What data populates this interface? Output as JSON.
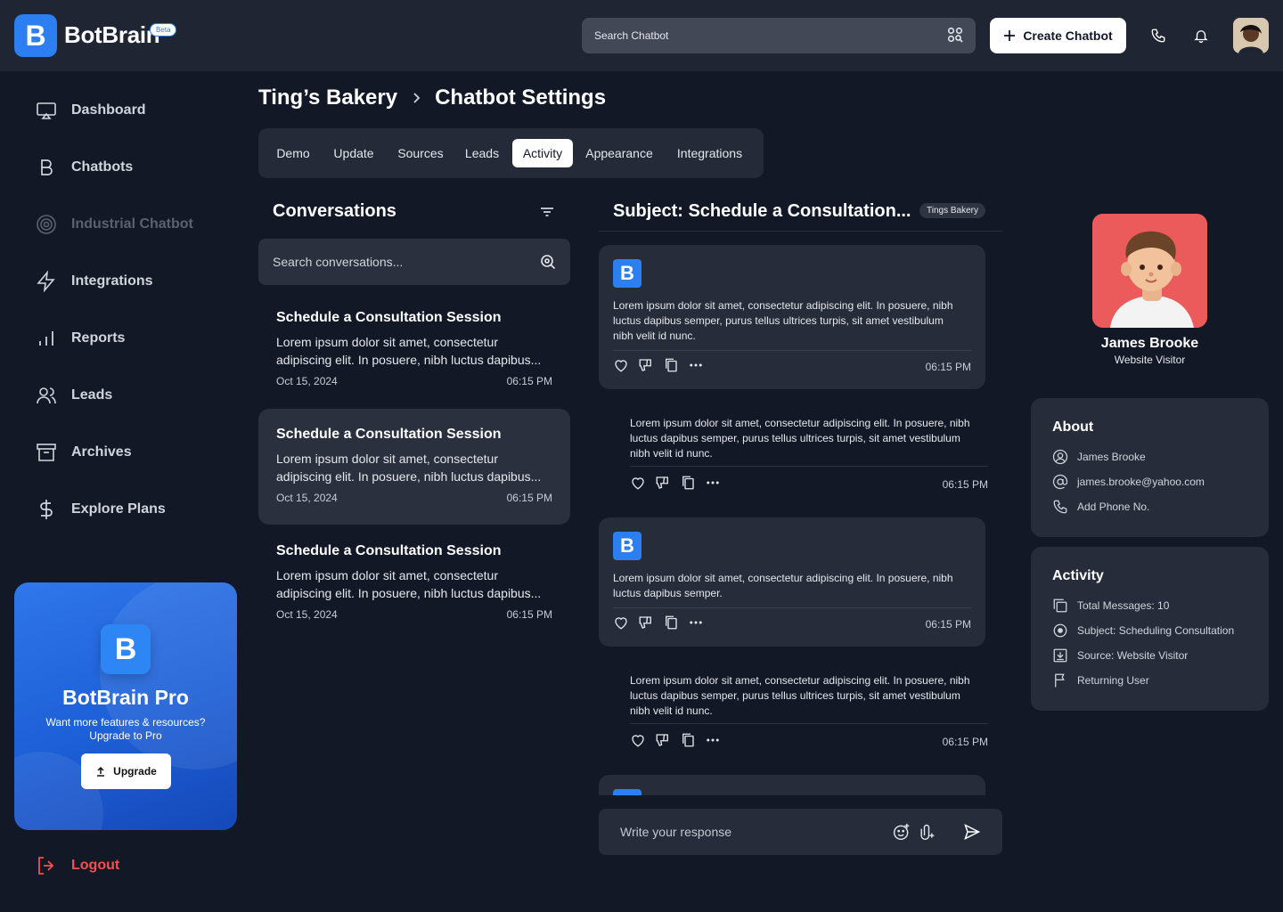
{
  "app": {
    "brand": "BotBrain",
    "beta_badge": "Beta",
    "logo_letter": "B"
  },
  "topbar": {
    "search_placeholder": "Search Chatbot",
    "create_button": "Create Chatbot"
  },
  "sidebar": {
    "items": [
      {
        "label": "Dashboard",
        "icon": "monitor-icon"
      },
      {
        "label": "Chatbots",
        "icon": "chatbot-b-icon"
      },
      {
        "label": "Industrial Chatbot",
        "icon": "target-icon",
        "disabled": true
      },
      {
        "label": "Integrations",
        "icon": "lightning-icon"
      },
      {
        "label": "Reports",
        "icon": "bar-chart-icon"
      },
      {
        "label": "Leads",
        "icon": "users-icon"
      },
      {
        "label": "Archives",
        "icon": "archive-icon"
      },
      {
        "label": "Explore Plans",
        "icon": "dollar-icon"
      }
    ],
    "promo": {
      "logo_letter": "B",
      "title": "BotBrain Pro",
      "desc_line1": "Want more features & resources?",
      "desc_line2": "Upgrade to Pro",
      "button": "Upgrade"
    },
    "logout": "Logout"
  },
  "breadcrumb": {
    "parent": "Ting’s Bakery",
    "current": "Chatbot Settings"
  },
  "tabs": [
    "Demo",
    "Update",
    "Sources",
    "Leads",
    "Activity",
    "Appearance",
    "Integrations"
  ],
  "active_tab": "Activity",
  "conversations": {
    "title": "Conversations",
    "search_placeholder": "Search conversations...",
    "items": [
      {
        "title": "Schedule a Consultation Session",
        "line1": "Lorem ipsum dolor sit amet, consectetur",
        "line2": "adipiscing elit. In posuere, nibh luctus dapibus...",
        "date": "Oct 15, 2024",
        "time": "06:15 PM"
      },
      {
        "title": "Schedule a Consultation Session",
        "line1": "Lorem ipsum dolor sit amet, consectetur",
        "line2": "adipiscing elit. In posuere, nibh luctus dapibus...",
        "date": "Oct 15, 2024",
        "time": "06:15 PM",
        "selected": true
      },
      {
        "title": "Schedule a Consultation Session",
        "line1": "Lorem ipsum dolor sit amet, consectetur",
        "line2": "adipiscing elit. In posuere, nibh luctus dapibus...",
        "date": "Oct 15, 2024",
        "time": "06:15 PM"
      }
    ]
  },
  "chat": {
    "subject": "Subject: Schedule a Consultation...",
    "tag": "Tings Bakery",
    "messages": [
      {
        "from": "bot",
        "lines": [
          "Lorem ipsum dolor sit amet, consectetur adipiscing elit. In posuere, nibh",
          "luctus dapibus semper, purus tellus ultrices turpis, sit amet vestibulum",
          "nibh velit id nunc."
        ],
        "time": "06:15 PM"
      },
      {
        "from": "user",
        "lines": [
          "Lorem ipsum dolor sit amet, consectetur adipiscing elit. In posuere, nibh",
          "luctus dapibus semper, purus tellus ultrices turpis, sit amet vestibulum",
          "nibh velit id nunc."
        ],
        "time": "06:15 PM"
      },
      {
        "from": "bot",
        "lines": [
          "Lorem ipsum dolor sit amet, consectetur adipiscing elit. In posuere, nibh",
          "luctus dapibus semper."
        ],
        "time": "06:15 PM"
      },
      {
        "from": "user",
        "lines": [
          "Lorem ipsum dolor sit amet, consectetur adipiscing elit. In posuere, nibh",
          "luctus dapibus semper, purus tellus ultrices turpis, sit amet vestibulum",
          "nibh velit id nunc."
        ],
        "time": "06:15 PM"
      }
    ],
    "composer_placeholder": "Write your response"
  },
  "visitor": {
    "name": "James Brooke",
    "role": "Website Visitor",
    "about": {
      "title": "About",
      "name": "James Brooke",
      "email": "james.brooke@yahoo.com",
      "phone": "Add Phone No."
    },
    "activity": {
      "title": "Activity",
      "total_messages": "Total Messages: 10",
      "subject": "Subject: Scheduling Consultation",
      "source": "Source: Website Visitor",
      "returning": "Returning User"
    }
  },
  "colors": {
    "accent": "#2b7ff0",
    "background": "#121826",
    "panel": "#262c39",
    "logout": "#f05252"
  }
}
